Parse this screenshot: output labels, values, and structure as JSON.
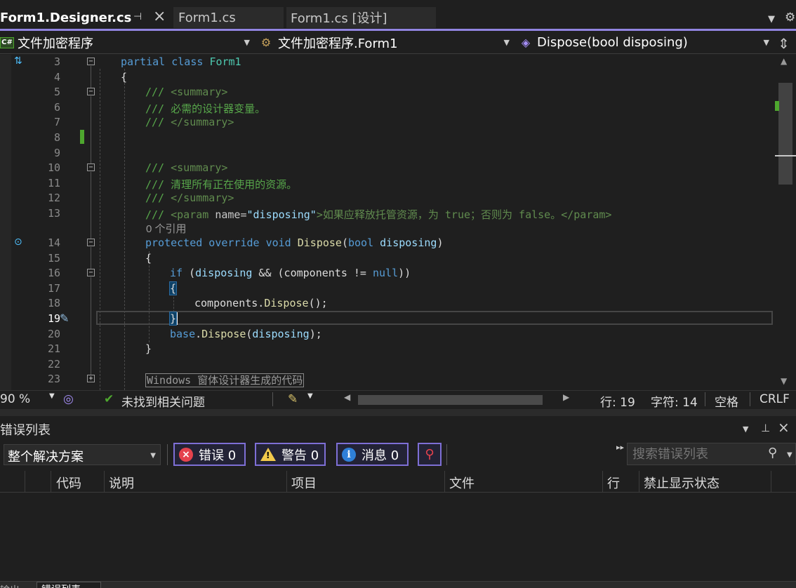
{
  "tabs": {
    "active": "Form1.Designer.cs",
    "form1": "Form1.cs",
    "form1_design": "Form1.cs [设计]",
    "pin_icon": "pin-icon",
    "close_icon": "close-icon"
  },
  "nav": {
    "project": "文件加密程序",
    "class": "文件加密程序.Form1",
    "member": "Dispose(bool disposing)",
    "project_badge": "C#"
  },
  "code": {
    "line_numbers": [
      "3",
      "4",
      "5",
      "6",
      "7",
      "8",
      "9",
      "10",
      "11",
      "12",
      "13",
      "14",
      "15",
      "16",
      "17",
      "18",
      "19",
      "20",
      "21",
      "22",
      "23"
    ],
    "current_line": "19",
    "l3_kw": "partial class",
    "l3_name": "Form1",
    "l4": "{",
    "l5_prefix": "/// ",
    "l5_tag": "<summary>",
    "l6": "/// 必需的设计器变量。",
    "l7_prefix": "/// ",
    "l7_tag": "</summary>",
    "l10_prefix": "/// ",
    "l10_tag": "<summary>",
    "l11": "/// 清理所有正在使用的资源。",
    "l12_prefix": "/// ",
    "l12_tag": "</summary>",
    "l13_prefix": "/// ",
    "l13_tag_open": "<param",
    "l13_attr": " name=",
    "l13_val": "\"disposing\"",
    "l13_text": ">如果应释放托管资源，为 true；否则为 false。</param>",
    "codelens": "0 个引用",
    "l14_kw": "protected override void",
    "l14_fn": "Dispose",
    "l14_open": "(",
    "l14_type": "bool",
    "l14_param": " disposing",
    "l14_close": ")",
    "l15": "{",
    "l16_kw": "if",
    "l16_a": " (",
    "l16_p": "disposing",
    "l16_b": " && (components != ",
    "l16_null": "null",
    "l16_c": "))",
    "l17": "{",
    "l18_a": "components.",
    "l18_fn": "Dispose",
    "l18_b": "();",
    "l19": "}",
    "l20_kw": "base",
    "l20_dot": ".",
    "l20_fn": "Dispose",
    "l20_a": "(",
    "l20_p": "disposing",
    "l20_b": ");",
    "l21": "}",
    "l23_region": "Windows 窗体设计器生成的代码"
  },
  "editor_status": {
    "zoom": "90 %",
    "issues": "未找到相关问题",
    "line": "行: 19",
    "char": "字符: 14",
    "whitespace": "空格",
    "eol": "CRLF"
  },
  "error_list": {
    "title": "错误列表",
    "scope": "整个解决方案",
    "errors_label": "错误 0",
    "warnings_label": "警告 0",
    "messages_label": "消息 0",
    "search_placeholder": "搜索错误列表",
    "columns": [
      "代码",
      "说明",
      "项目",
      "文件",
      "行",
      "禁止显示状态"
    ]
  },
  "bottom_tabs": {
    "output": "输出",
    "errors": "错误列表"
  },
  "colors": {
    "accent": "#9184e0",
    "keyword": "#569cd6",
    "type": "#4ec9b0",
    "comment": "#57a64a",
    "error": "#e5424d",
    "warning": "#f2c94c",
    "info": "#2f7fd8"
  }
}
